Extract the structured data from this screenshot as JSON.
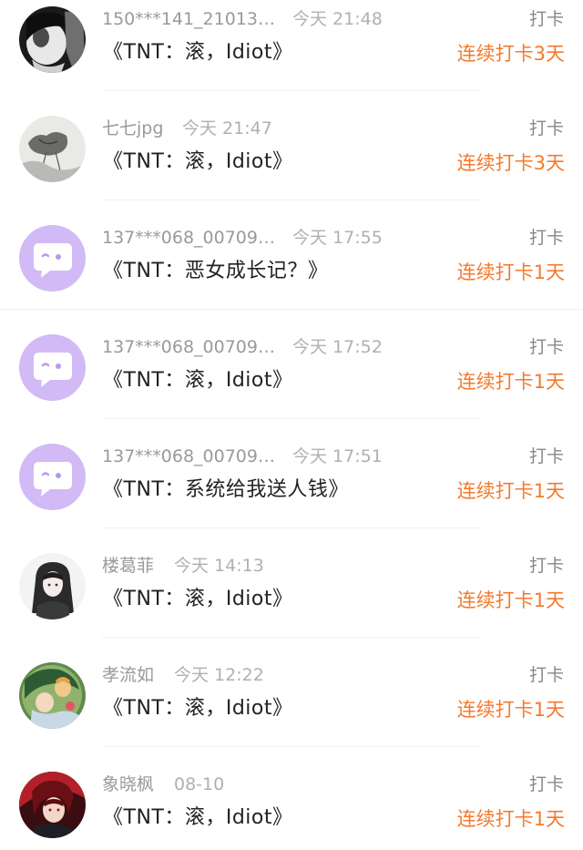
{
  "colors": {
    "streak": "#f47a2d",
    "meta": "#9c9c9c",
    "title": "#222222",
    "default_avatar_bg": "#d1baf5"
  },
  "entries": [
    {
      "username": "150***141_21013…",
      "time": "今天 21:48",
      "book": "《TNT：滚，Idiot》",
      "checkin_label": "打卡",
      "streak": "连续打卡3天",
      "avatar": "user-photo-avatar-bw"
    },
    {
      "username": "七七jpg",
      "time": "今天 21:47",
      "book": "《TNT：滚，Idiot》",
      "checkin_label": "打卡",
      "streak": "连续打卡3天",
      "avatar": "user-photo-avatar-sketch"
    },
    {
      "username": "137***068_00709…",
      "time": "今天 17:55",
      "book": "《TNT：恶女成长记？》",
      "checkin_label": "打卡",
      "streak": "连续打卡1天",
      "avatar": "default-chat-bubble-avatar"
    },
    {
      "username": "137***068_00709…",
      "time": "今天 17:52",
      "book": "《TNT：滚，Idiot》",
      "checkin_label": "打卡",
      "streak": "连续打卡1天",
      "avatar": "default-chat-bubble-avatar"
    },
    {
      "username": "137***068_00709…",
      "time": "今天 17:51",
      "book": "《TNT：系统给我送人钱》",
      "checkin_label": "打卡",
      "streak": "连续打卡1天",
      "avatar": "default-chat-bubble-avatar"
    },
    {
      "username": "楼葛菲",
      "time": "今天 14:13",
      "book": "《TNT：滚，Idiot》",
      "checkin_label": "打卡",
      "streak": "连续打卡1天",
      "avatar": "user-photo-avatar-anime-girl"
    },
    {
      "username": "孝流如",
      "time": "今天 12:22",
      "book": "《TNT：滚，Idiot》",
      "checkin_label": "打卡",
      "streak": "连续打卡1天",
      "avatar": "user-photo-avatar-colorful"
    },
    {
      "username": "象晓枫",
      "time": "08-10",
      "book": "《TNT：滚，Idiot》",
      "checkin_label": "打卡",
      "streak": "连续打卡1天",
      "avatar": "user-photo-avatar-anime-red"
    }
  ]
}
